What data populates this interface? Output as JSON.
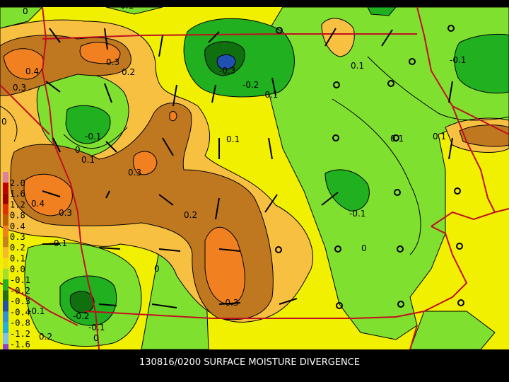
{
  "title": "130816/0200 SURFACE MOISTURE DIVERGENCE",
  "legend": {
    "levels": [
      {
        "label": "2.0",
        "color": "#e080a0"
      },
      {
        "label": "1.6",
        "color": "#c00000"
      },
      {
        "label": "1.2",
        "color": "#a00000"
      },
      {
        "label": "0.8",
        "color": "#e03000"
      },
      {
        "label": "0.4",
        "color": "#b86000"
      },
      {
        "label": "0.3",
        "color": "#f08020"
      },
      {
        "label": "0.2",
        "color": "#c88020"
      },
      {
        "label": "0.1",
        "color": "#f8b830"
      },
      {
        "label": "0.0",
        "color": "#f0e010"
      },
      {
        "label": "-0.1",
        "color": "#a0e030"
      },
      {
        "label": "-0.2",
        "color": "#20b020"
      },
      {
        "label": "-0.3",
        "color": "#207020"
      },
      {
        "label": "-0.4",
        "color": "#2050b0"
      },
      {
        "label": "-0.8",
        "color": "#3090e0"
      },
      {
        "label": "-1.2",
        "color": "#20b0e0"
      },
      {
        "label": "-1.6",
        "color": "#80c0f0"
      },
      {
        "label": "",
        "color": "#9040d0"
      }
    ]
  },
  "contour_labels": [
    "0",
    "0.1",
    "0.3",
    "0.2",
    "0.4",
    "0.3",
    "-0.3",
    "-0.2",
    "-0.1",
    "0.1",
    "-0.1",
    "0",
    "-0.1",
    "0.1",
    "0.1",
    "0.3",
    "0.2",
    "0.4",
    "0.3",
    "0.1",
    "-0.1",
    "0",
    "0",
    "-0.3",
    "-0.2",
    "-0.1",
    "0",
    "-0.1",
    "0.2",
    "0",
    "0.1",
    "0.1"
  ],
  "colors": {
    "yellow": "#f0f000",
    "light_green": "#80e030",
    "green": "#20b020",
    "dark_green": "#107010",
    "blue": "#2050b0",
    "light_orange": "#f8c040",
    "brown": "#c07820",
    "orange": "#f08020",
    "state_border": "#c01020"
  }
}
